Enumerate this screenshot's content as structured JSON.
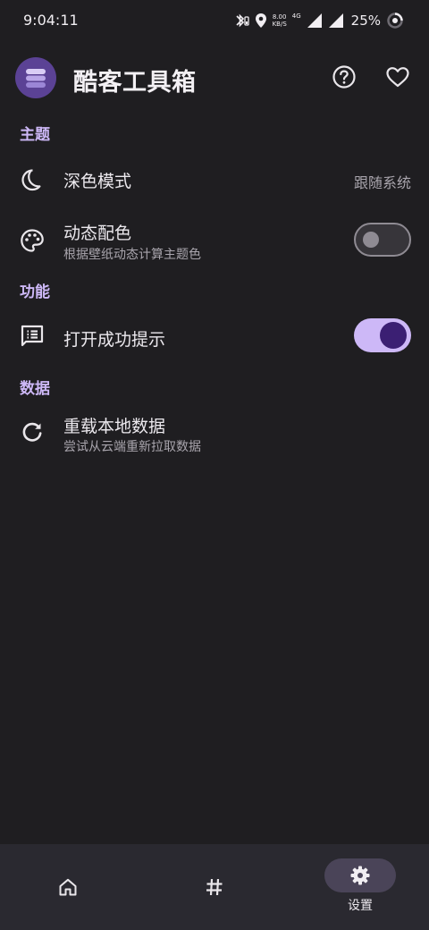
{
  "status": {
    "time": "9:04:11",
    "net_speed_value": "8.00",
    "net_speed_unit": "KB/S",
    "network_type": "4G",
    "battery": "25%"
  },
  "app": {
    "title": "酷客工具箱"
  },
  "sections": {
    "theme": "主题",
    "features": "功能",
    "data": "数据"
  },
  "settings": {
    "dark_mode": {
      "title": "深色模式",
      "value": "跟随系统"
    },
    "dynamic_color": {
      "title": "动态配色",
      "subtitle": "根据壁纸动态计算主题色",
      "enabled": false
    },
    "open_success_hint": {
      "title": "打开成功提示",
      "enabled": true
    },
    "reload_local_data": {
      "title": "重载本地数据",
      "subtitle": "尝试从云端重新拉取数据"
    }
  },
  "nav": {
    "selected": "settings",
    "settings_label": "设置"
  },
  "colors": {
    "background": "#1f1e21",
    "accent": "#cdb8f7",
    "switch_on_knob": "#3b1f73",
    "nav_background": "#2a2930",
    "nav_active_pill": "#4a4458"
  },
  "icons": {
    "help": "help-circle-icon",
    "favorite": "heart-outline-icon",
    "dark_mode": "moon-icon",
    "dynamic_color": "palette-icon",
    "hint": "message-text-icon",
    "reload": "refresh-icon",
    "home": "home-icon",
    "tags": "hash-icon",
    "settings": "gear-icon"
  }
}
